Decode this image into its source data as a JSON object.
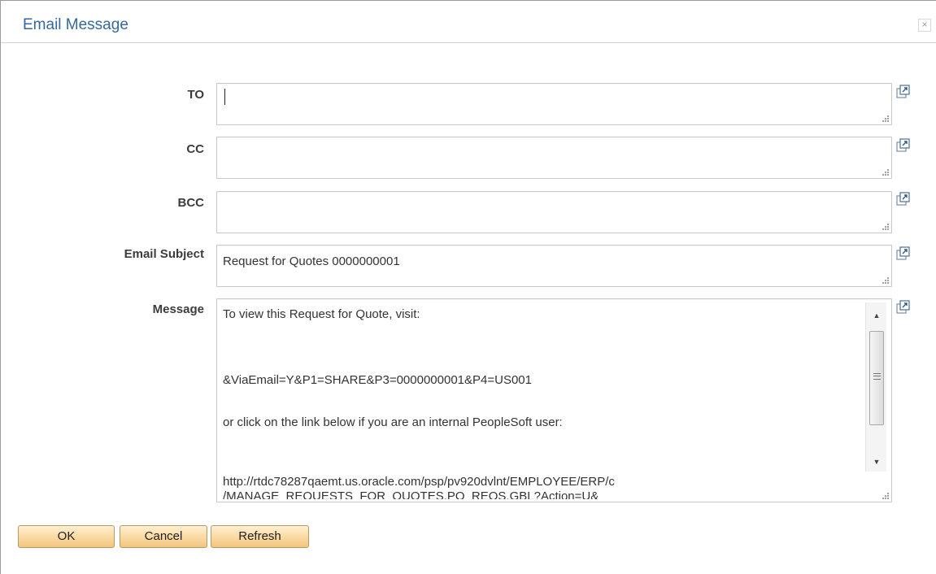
{
  "dialog": {
    "title": "Email Message",
    "close_glyph": "×"
  },
  "fields": {
    "to": {
      "label": "TO",
      "value": ""
    },
    "cc": {
      "label": "CC",
      "value": ""
    },
    "bcc": {
      "label": "BCC",
      "value": ""
    },
    "subject": {
      "label": "Email Subject",
      "value": "Request for Quotes 0000000001"
    },
    "message": {
      "label": "Message",
      "lines": [
        "To view this Request for Quote, visit:",
        "",
        "",
        "&ViaEmail=Y&P1=SHARE&P3=0000000001&P4=US001",
        "",
        "or click on the link below if you are an internal PeopleSoft user:",
        "",
        "",
        "http://rtdc78287qaemt.us.oracle.com/psp/pv920dvlnt/EMPLOYEE/ERP/c",
        "/MANAGE_REQUESTS_FOR_QUOTES.PO_REQS.GBL?Action=U&"
      ]
    }
  },
  "icons": {
    "expand": "expand-field-icon",
    "resize": "resize-grip-icon",
    "scroll_up": "▲",
    "scroll_down": "▼"
  },
  "buttons": {
    "ok": "OK",
    "cancel": "Cancel",
    "refresh": "Refresh"
  }
}
